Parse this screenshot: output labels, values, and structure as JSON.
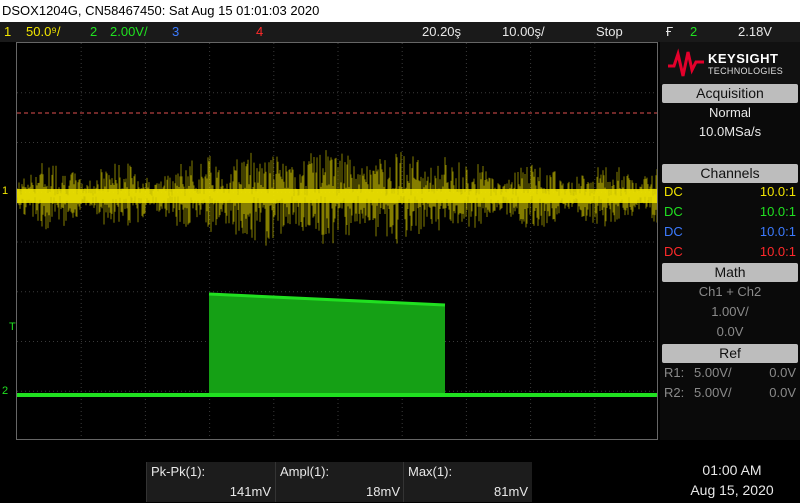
{
  "title_bar": {
    "text": "DSOX1204G, CN58467450: Sat Aug 15 01:01:03 2020"
  },
  "status": {
    "ch1_num": "1",
    "ch1_scale": "50.0⁹/",
    "ch2_num": "2",
    "ch2_scale": "2.00V/",
    "ch3_num": "3",
    "ch4_num": "4",
    "time_delay": "20.20ş",
    "time_scale": "10.00ş/",
    "run_state": "Stop",
    "trigger_icon": "Ғ",
    "trigger_ch": "2",
    "trigger_level": "2.18V"
  },
  "brand": {
    "name": "KEYSIGHT",
    "sub": "TECHNOLOGIES"
  },
  "acquisition": {
    "header": "Acquisition",
    "mode": "Normal",
    "rate": "10.0MSa/s"
  },
  "channels": {
    "header": "Channels",
    "rows": [
      {
        "coupling": "DC",
        "probe": "10.0:1"
      },
      {
        "coupling": "DC",
        "probe": "10.0:1"
      },
      {
        "coupling": "DC",
        "probe": "10.0:1"
      },
      {
        "coupling": "DC",
        "probe": "10.0:1"
      }
    ]
  },
  "math": {
    "header": "Math",
    "func": "Ch1 + Ch2",
    "scale": "1.00V/",
    "offset": "0.0V"
  },
  "ref": {
    "header": "Ref",
    "rows": [
      {
        "name": "R1:",
        "scale": "5.00V/",
        "offset": "0.0V"
      },
      {
        "name": "R2:",
        "scale": "5.00V/",
        "offset": "0.0V"
      }
    ]
  },
  "markers": {
    "ch1": "1",
    "ch2": "2",
    "trig": "T"
  },
  "measurements": [
    {
      "label": "Pk-Pk(1):",
      "value": "141mV"
    },
    {
      "label": "Ampl(1):",
      "value": "18mV"
    },
    {
      "label": "Max(1):",
      "value": "81mV"
    }
  ],
  "clock": {
    "time": "01:00 AM",
    "date": "Aug 15, 2020"
  },
  "colors": {
    "ch1": "#f2e600",
    "ch2": "#20e020",
    "ch3": "#3b7bff",
    "ch4": "#ff2a2a"
  }
}
